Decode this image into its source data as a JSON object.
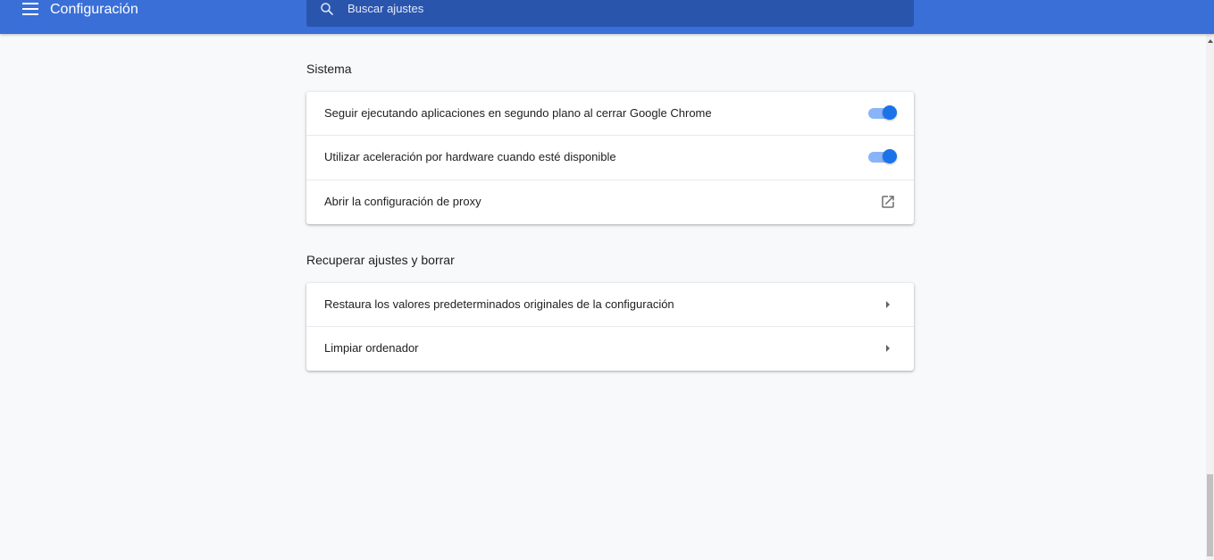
{
  "header": {
    "title": "Configuración",
    "menu_icon": "hamburger-menu-icon",
    "search_icon": "search-icon",
    "search_placeholder": "Buscar ajustes",
    "search_value": "",
    "colors": {
      "bar": "#3a6fd8",
      "search_bg": "#2a55ad"
    }
  },
  "sections": {
    "sistema": {
      "title": "Sistema",
      "rows": [
        {
          "label": "Seguir ejecutando aplicaciones en segundo plano al cerrar Google Chrome",
          "control": "toggle",
          "checked": true
        },
        {
          "label": "Utilizar aceleración por hardware cuando esté disponible",
          "control": "toggle",
          "checked": true
        },
        {
          "label": "Abrir la configuración de proxy",
          "control": "external-link-icon"
        }
      ]
    },
    "reset": {
      "title": "Recuperar ajustes y borrar",
      "rows": [
        {
          "label": "Restaura los valores predeterminados originales de la configuración",
          "control": "arrow-right-icon"
        },
        {
          "label": "Limpiar ordenador",
          "control": "arrow-right-icon"
        }
      ]
    }
  },
  "colors": {
    "toggle_on_knob": "#1a73e8",
    "toggle_on_track": "#8ab4f8",
    "page_bg": "#f8f9fa"
  }
}
